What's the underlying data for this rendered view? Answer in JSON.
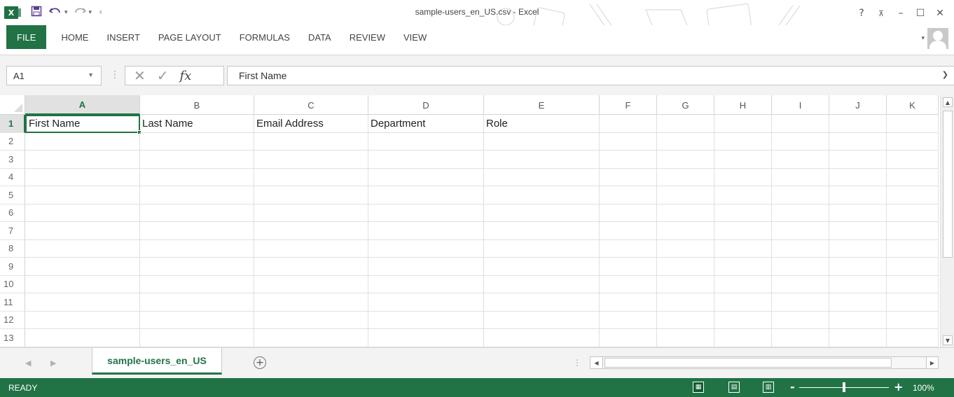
{
  "window": {
    "title": "sample-users_en_US.csv - Excel",
    "help": "?",
    "ribbon_display": "⊼",
    "minimize": "–",
    "maximize": "☐",
    "close": "✕"
  },
  "quick_access": {
    "logo": "X",
    "save_icon": "floppy-disk",
    "undo_icon": "undo-arrow",
    "redo_icon": "redo-arrow"
  },
  "ribbon": {
    "tabs": [
      "FILE",
      "HOME",
      "INSERT",
      "PAGE LAYOUT",
      "FORMULAS",
      "DATA",
      "REVIEW",
      "VIEW"
    ]
  },
  "formula_bar": {
    "name_box": "A1",
    "cancel": "✕",
    "enter": "✓",
    "fx": "fx",
    "content": "First Name"
  },
  "sheet": {
    "columns": [
      "A",
      "B",
      "C",
      "D",
      "E",
      "F",
      "G",
      "H",
      "I",
      "J",
      "K"
    ],
    "rows": [
      "1",
      "2",
      "3",
      "4",
      "5",
      "6",
      "7",
      "8",
      "9",
      "10",
      "11",
      "12",
      "13"
    ],
    "selected_cell": "A1",
    "cells": {
      "A1": "First Name",
      "B1": "Last Name",
      "C1": "Email Address",
      "D1": "Department",
      "E1": "Role"
    }
  },
  "sheet_tabs": {
    "active": "sample-users_en_US",
    "add": "+"
  },
  "status": {
    "mode": "READY",
    "zoom_minus": "-",
    "zoom_plus": "+",
    "zoom": "100%",
    "zoom_level": 1.0
  },
  "colors": {
    "accent": "#217346",
    "statusbar": "#217346"
  }
}
